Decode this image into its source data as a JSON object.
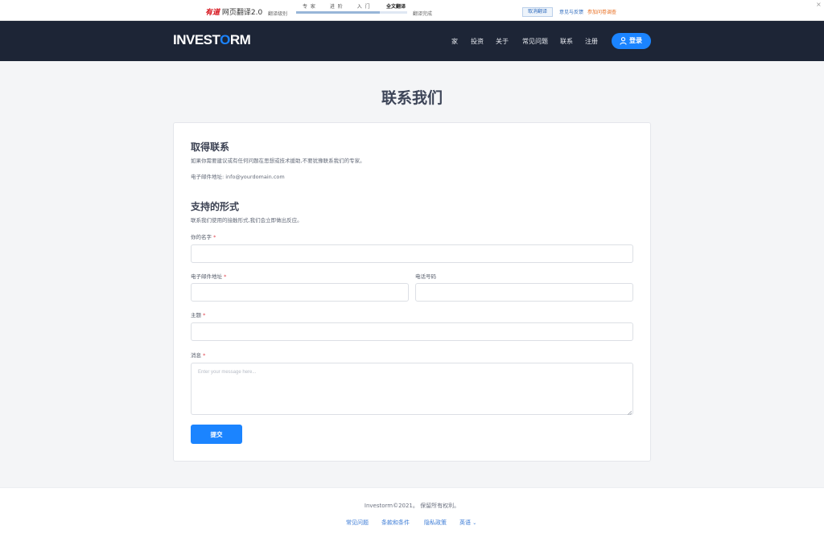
{
  "translate_bar": {
    "brand_logo": "有道",
    "brand_name": "网页翻译2.0",
    "progress_label": "翻译级别",
    "steps": [
      "专 家",
      "进 阶",
      "入 门"
    ],
    "full_translate": "全文翻译",
    "progress_done": "翻译完成",
    "progress_fraction": 0.75,
    "cancel_label": "取消翻译",
    "feedback_label": "意见与反馈",
    "survey_label": "参加问卷调查",
    "close_label": "×"
  },
  "nav": {
    "logo": {
      "pre": "INVEST",
      "accent": "O",
      "post": "RM"
    },
    "items": [
      "家",
      "投资",
      "关于",
      "常见问题",
      "联系",
      "注册"
    ],
    "login_label": "登录"
  },
  "page": {
    "title": "联系我们"
  },
  "contact_info": {
    "heading": "取得联系",
    "description": "如果你需要建议或有任何问题在思想或技术援助,不要犹豫联系我们的专家。",
    "email_line": "电子邮件地址: info@yourdomain.com"
  },
  "form": {
    "heading": "支持的形式",
    "description": "联系我们使用的接触形式,我们会立即做出反应。",
    "required_mark": "*",
    "name_label": "你的名字",
    "email_label": "电子邮件地址",
    "phone_label": "电话号码",
    "subject_label": "主题",
    "message_label": "消息",
    "message_placeholder": "Enter your message here...",
    "submit_label": "提交"
  },
  "footer": {
    "copyright": "Investorm©2021。 保留所有权利。",
    "links": [
      "常见问题",
      "条款和条件",
      "隐私政策"
    ],
    "language_label": "英语",
    "language_caret": "⌄"
  },
  "colors": {
    "navbar": "#1d2536",
    "accent": "#1b84ff",
    "page_bg": "#f4f5f7",
    "card_bg": "#ffffff"
  }
}
